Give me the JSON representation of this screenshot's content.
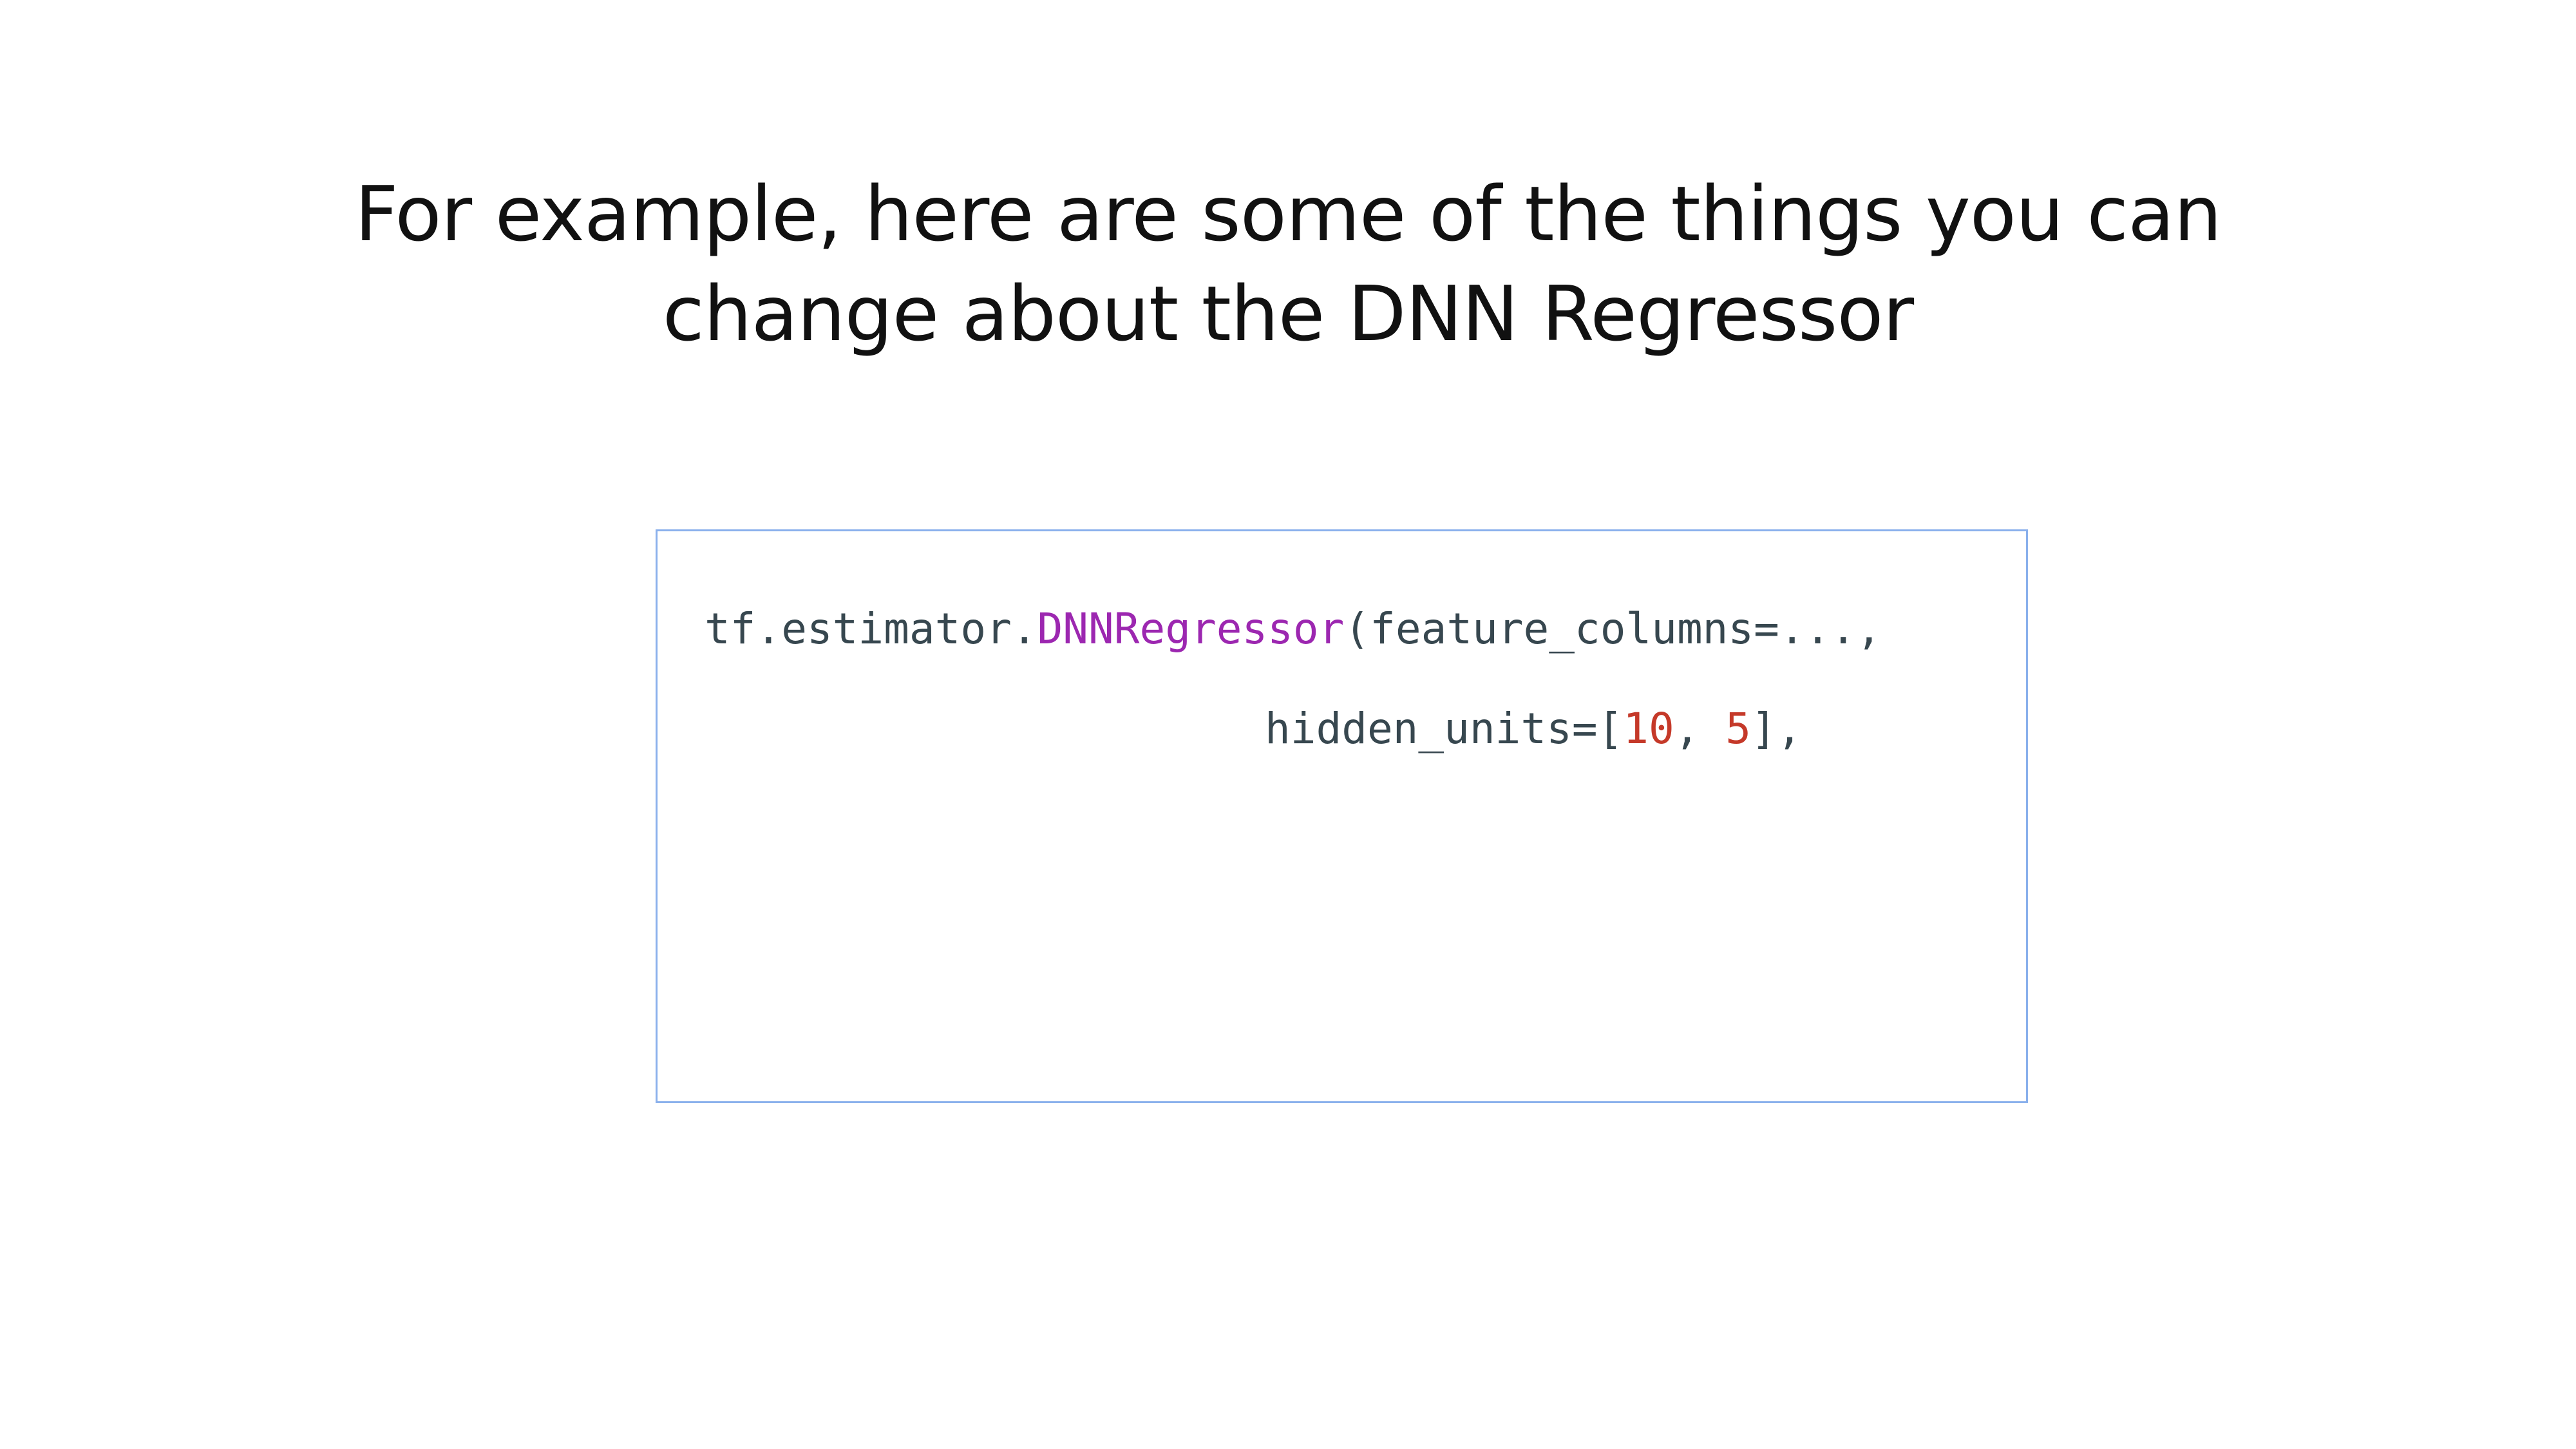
{
  "slide": {
    "title_lines": [
      "For example, here are some of the things you can",
      "change about the DNN Regressor"
    ]
  },
  "code": {
    "line1": {
      "prefix": "tf.estimator.",
      "class_name": "DNNRegressor",
      "args": "(feature_columns=...,"
    },
    "line2": {
      "prefix": "hidden_units=[",
      "num1": "10",
      "separator": ", ",
      "num2": "5",
      "suffix": "],"
    }
  },
  "colors": {
    "title_text": "#111111",
    "code_text": "#37474f",
    "code_class_name": "#9c27b0",
    "code_number": "#c53929",
    "code_box_border": "#8ab0ec"
  }
}
